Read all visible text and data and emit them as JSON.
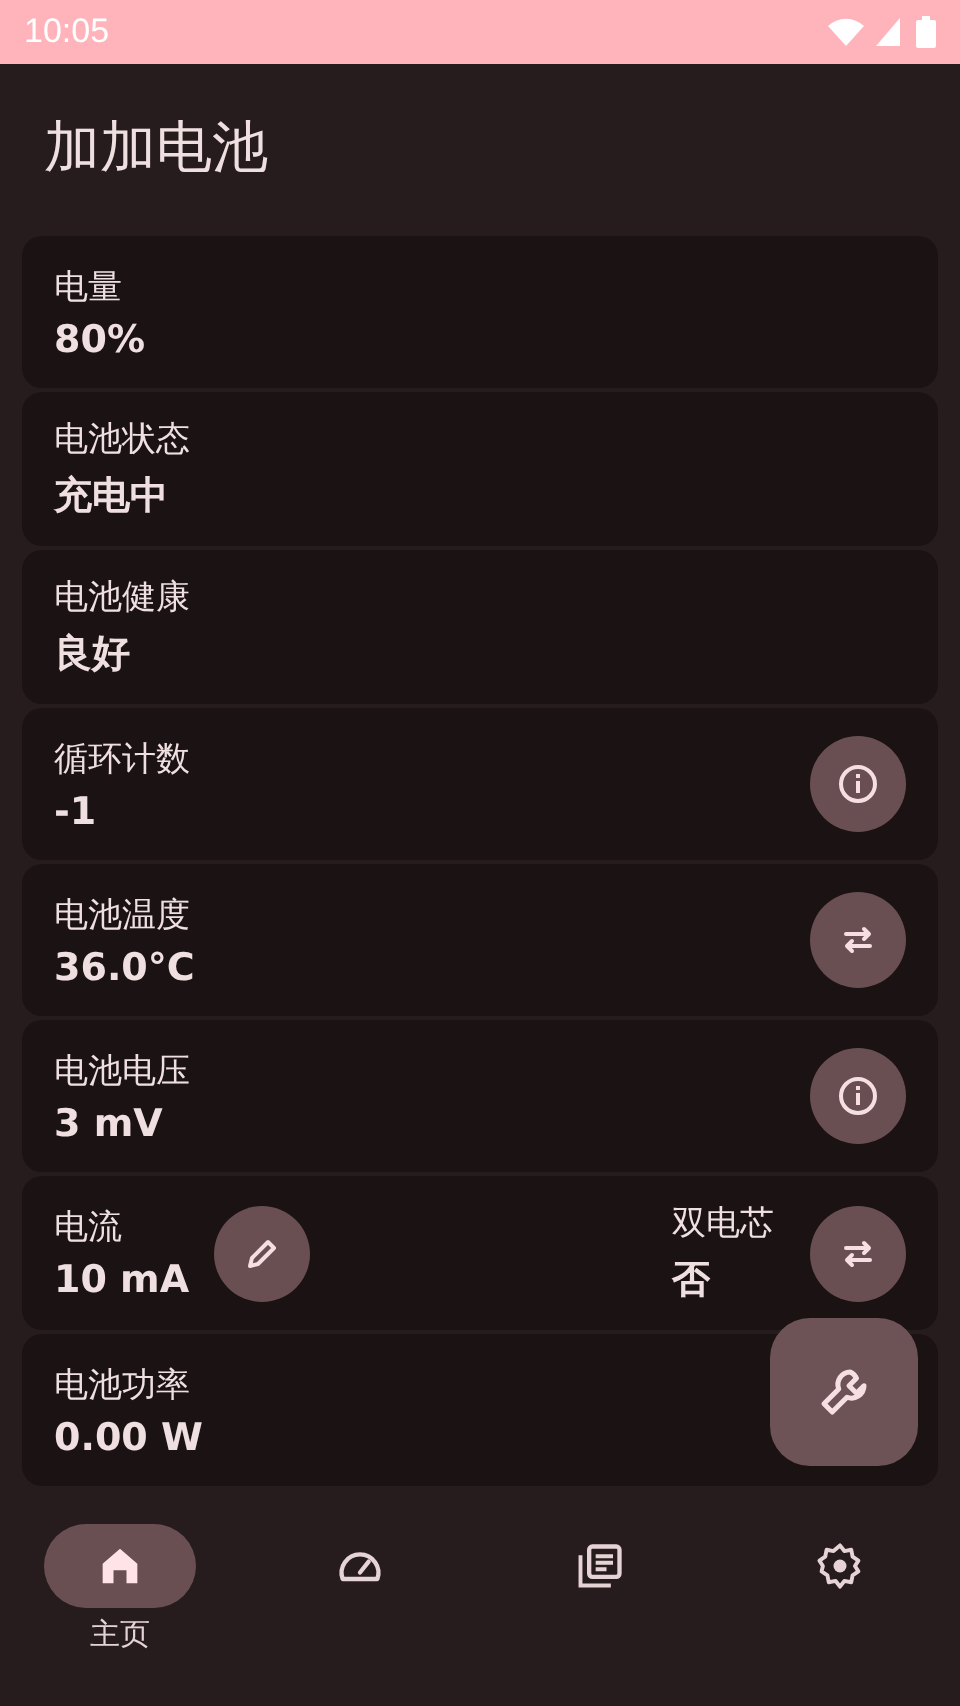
{
  "status_bar": {
    "time": "10:05"
  },
  "title": "加加电池",
  "cards": [
    {
      "label": "电量",
      "value": "80%"
    },
    {
      "label": "电池状态",
      "value": "充电中"
    },
    {
      "label": "电池健康",
      "value": "良好"
    },
    {
      "label": "循环计数",
      "value": "-1",
      "action": {
        "kind": "info"
      }
    },
    {
      "label": "电池温度",
      "value": "36.0°C",
      "action": {
        "kind": "swap"
      }
    },
    {
      "label": "电池电压",
      "value": "3 mV",
      "action": {
        "kind": "info"
      }
    },
    {
      "label": "电流",
      "value": "10 mA",
      "action": {
        "kind": "edit"
      },
      "extra": {
        "label": "双电芯",
        "value": "否",
        "action": {
          "kind": "swap"
        }
      }
    },
    {
      "label": "电池功率",
      "value": "0.00 W"
    }
  ],
  "fab": {
    "kind": "wrench"
  },
  "nav": [
    {
      "kind": "home",
      "label": "主页",
      "selected": true
    },
    {
      "kind": "gauge",
      "selected": false
    },
    {
      "kind": "list",
      "selected": false
    },
    {
      "kind": "settings",
      "selected": false
    }
  ]
}
